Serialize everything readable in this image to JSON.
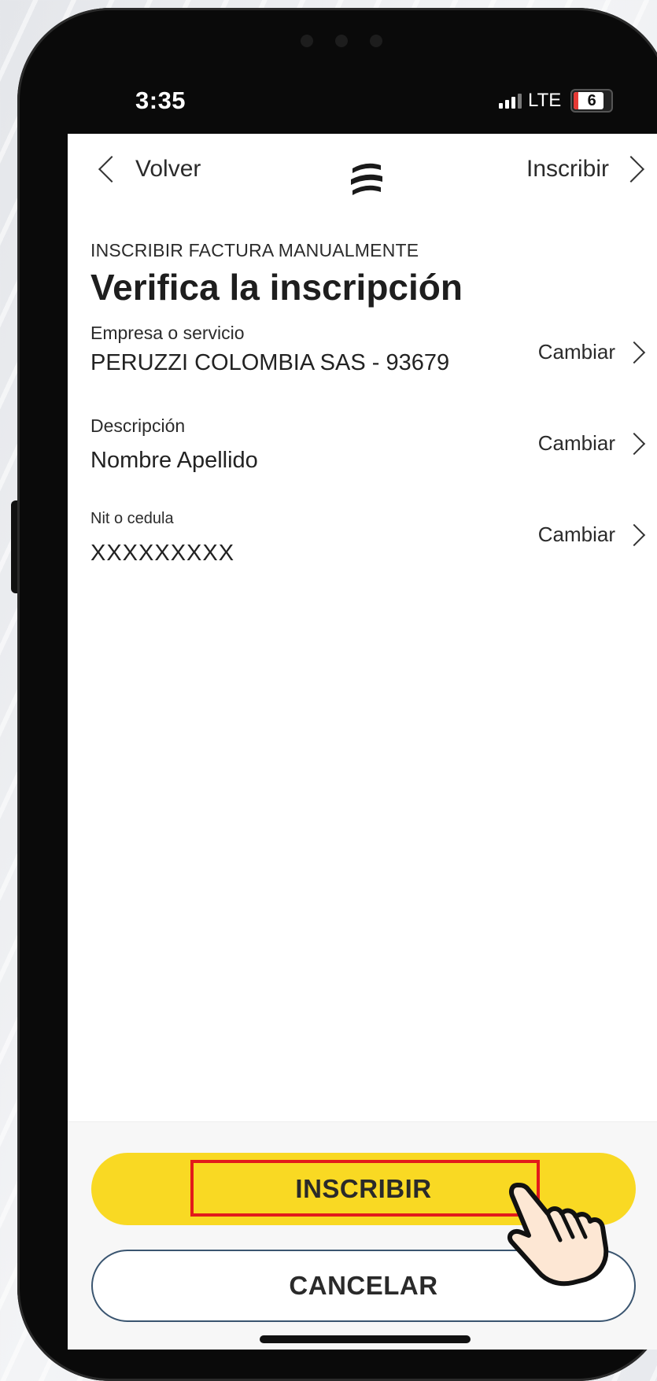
{
  "status_bar": {
    "time": "3:35",
    "network": "LTE",
    "battery": "6"
  },
  "nav": {
    "back_label": "Volver",
    "next_label": "Inscribir"
  },
  "header": {
    "kicker": "INSCRIBIR FACTURA MANUALMENTE",
    "title": "Verifica la inscripción"
  },
  "fields": [
    {
      "label": "Empresa o servicio",
      "value": "PERUZZI COLOMBIA SAS - 93679",
      "action": "Cambiar"
    },
    {
      "label": "Descripción",
      "value": "Nombre Apellido",
      "action": "Cambiar"
    },
    {
      "label": "Nit o cedula",
      "value": "XXXXXXXXX",
      "action": "Cambiar"
    }
  ],
  "actions": {
    "primary_label": "INSCRIBIR",
    "secondary_label": "CANCELAR"
  },
  "colors": {
    "accent": "#f9d923",
    "highlight": "#e21b1b",
    "secondary_border": "#3a5570"
  }
}
